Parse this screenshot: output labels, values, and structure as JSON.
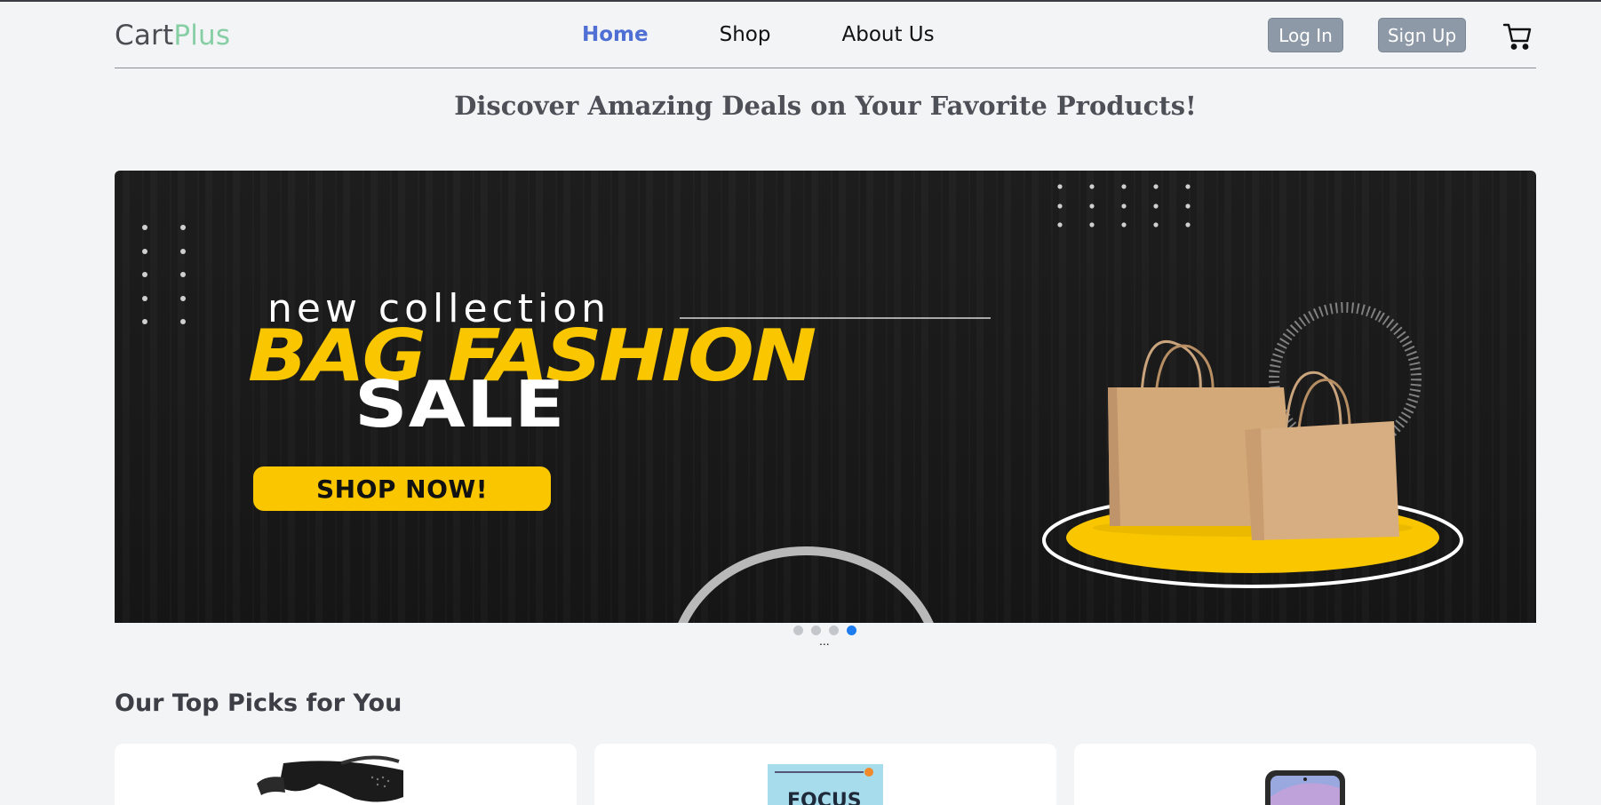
{
  "logo": {
    "part1": "Cart",
    "part2": "Plus"
  },
  "nav": {
    "home": "Home",
    "shop": "Shop",
    "about": "About Us"
  },
  "auth": {
    "login": "Log In",
    "signup": "Sign Up"
  },
  "headline": "Discover Amazing Deals on Your Favorite Products!",
  "banner": {
    "line1": "new collection",
    "line2": "BAG FASHION",
    "line3": "SALE",
    "cta": "SHOP NOW!"
  },
  "carousel": {
    "slide_count": 4,
    "active_index": 3,
    "ellipsis": "..."
  },
  "top_picks": {
    "title": "Our Top Picks for You",
    "products": [
      {
        "icon": "smart-glasses-image"
      },
      {
        "icon": "book-cover-image",
        "cover_text": "FOCUS"
      },
      {
        "icon": "smartphone-image"
      }
    ]
  },
  "colors": {
    "background": "#f3f4f6",
    "accent_nav": "#4f6fd4",
    "logo_plus": "#86cfa4",
    "button_bg": "#8d99a6",
    "banner_yellow": "#f9c600",
    "dot_active": "#1c7cf0"
  }
}
